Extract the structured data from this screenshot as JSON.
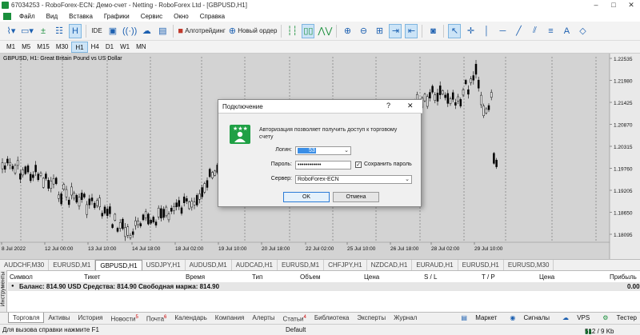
{
  "window": {
    "title": "67034253 - RoboForex-ECN: Демо-счет - Netting - RoboForex Ltd - [GBPUSD,H1]",
    "min": "–",
    "max": "□",
    "close": "✕"
  },
  "menu": [
    "Файл",
    "Вид",
    "Вставка",
    "Графики",
    "Сервис",
    "Окно",
    "Справка"
  ],
  "toolbar": {
    "algo_label": "Алготрейдинг",
    "new_order_label": "Новый ордер",
    "ide_label": "IDE"
  },
  "timeframes": [
    "M1",
    "M5",
    "M15",
    "M30",
    "H1",
    "H4",
    "D1",
    "W1",
    "MN"
  ],
  "active_timeframe": "H1",
  "chart": {
    "label": "GBPUSD, H1:  Great Britain Pound vs US Dollar",
    "price_ticks": [
      "1.22535",
      "1.21980",
      "1.21425",
      "1.20870",
      "1.20315",
      "1.19760",
      "1.19205",
      "1.18650",
      "1.18095"
    ],
    "time_ticks": [
      "8 Jul 2022",
      "12 Jul 00:00",
      "13 Jul 10:00",
      "14 Jul 18:00",
      "18 Jul 02:00",
      "19 Jul 10:00",
      "20 Jul 18:00",
      "22 Jul 02:00",
      "25 Jul 10:00",
      "26 Jul 18:00",
      "28 Jul 02:00",
      "29 Jul 10:00"
    ]
  },
  "chart_tabs": [
    "AUDCHF,M30",
    "EURUSD,M1",
    "GBPUSD,H1",
    "USDJPY,H1",
    "AUDUSD,M1",
    "AUDCAD,H1",
    "EURUSD,M1",
    "CHFJPY,H1",
    "NZDCAD,H1",
    "EURAUD,H1",
    "EURUSD,H1",
    "EURUSD,M30"
  ],
  "active_chart_tab": "GBPUSD,H1",
  "terminal": {
    "side_label": "Инструменты",
    "columns": [
      "Символ",
      "Тикет",
      "Время",
      "Тип",
      "Объем",
      "Цена",
      "S / L",
      "T / P",
      "Цена",
      "Прибыль"
    ],
    "balance_text": "Баланс: 814.90 USD  Средства: 814.90  Свободная маржа: 814.90",
    "profit": "0.00"
  },
  "bottom_tabs": [
    {
      "label": "Торговля",
      "badge": ""
    },
    {
      "label": "Активы",
      "badge": ""
    },
    {
      "label": "История",
      "badge": ""
    },
    {
      "label": "Новости",
      "badge": "5"
    },
    {
      "label": "Почта",
      "badge": "6"
    },
    {
      "label": "Календарь",
      "badge": ""
    },
    {
      "label": "Компания",
      "badge": ""
    },
    {
      "label": "Алерты",
      "badge": ""
    },
    {
      "label": "Статьи",
      "badge": "4"
    },
    {
      "label": "Библиотека",
      "badge": ""
    },
    {
      "label": "Эксперты",
      "badge": ""
    },
    {
      "label": "Журнал",
      "badge": ""
    }
  ],
  "right_status": {
    "market": "Маркет",
    "signals": "Сигналы",
    "vps": "VPS",
    "tester": "Тестер"
  },
  "statusbar": {
    "help": "Для вызова справки нажмите F1",
    "profile": "Default",
    "traffic": "512 / 9 Kb"
  },
  "dialog": {
    "title": "Подключение",
    "help": "?",
    "close": "✕",
    "message": "Авторизация позволяет получить доступ к торговому счету",
    "login_label": "Логин:",
    "login_value": "53",
    "password_label": "Пароль:",
    "password_value": "••••••••••••",
    "save_password_label": "Сохранить пароль",
    "server_label": "Сервер:",
    "server_value": "RoboForex-ECN",
    "ok_label": "OK",
    "cancel_label": "Отмена"
  },
  "colors": {
    "chart_bg": "#d3d3d3",
    "candle": "#000000",
    "accent": "#1fa045",
    "selection": "#cce4f7"
  }
}
